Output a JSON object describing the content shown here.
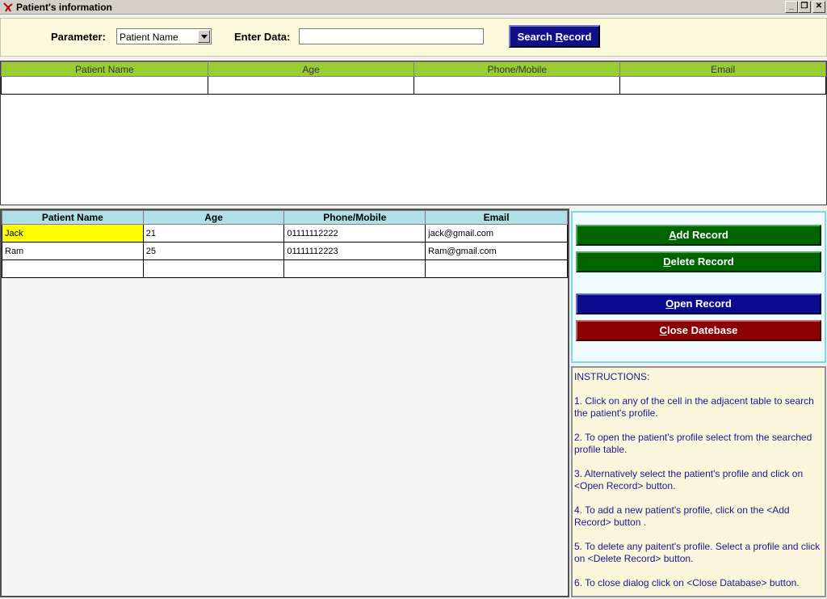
{
  "window": {
    "title": "Patient's information"
  },
  "search": {
    "parameter_label": "Parameter:",
    "parameter_value": "Patient Name",
    "enter_data_label": "Enter Data:",
    "data_value": "",
    "button_pre": "Search ",
    "button_key": "R",
    "button_post": "ecord"
  },
  "top_grid": {
    "columns": [
      "Patient Name",
      "Age",
      "Phone/Mobile",
      "Email"
    ]
  },
  "bottom_grid": {
    "columns": [
      "Patient Name",
      "Age",
      "Phone/Mobile",
      "Email"
    ],
    "rows": [
      {
        "name": "Jack",
        "age": "21",
        "phone": "01111112222",
        "email": "jack@gmail.com"
      },
      {
        "name": "Ram",
        "age": "25",
        "phone": "01111112223",
        "email": "Ram@gmail.com"
      }
    ]
  },
  "actions": {
    "add": {
      "key": "A",
      "rest": "dd Record"
    },
    "delete": {
      "key": "D",
      "rest": "elete Record"
    },
    "open": {
      "key": "O",
      "rest": "pen Record"
    },
    "close": {
      "key": "C",
      "rest": "lose Datebase"
    }
  },
  "instructions": {
    "heading": "INSTRUCTIONS:",
    "items": [
      "1. Click on any of the cell in the adjacent table to search the patient's profile.",
      "2. To open the patient's profile select from the searched profile table.",
      "3. Alternatively select the patient's profile and click on <Open Record> button.",
      "4. To add a new patient's profile, click on the <Add Record> button .",
      "5. To delete any paitent's profile. Select a profile and click on <Delete Record> button.",
      "6. To close dialog click on <Close Database> button."
    ]
  },
  "colors": {
    "top_header": "#9acd32",
    "bottom_header": "#b0e0e6",
    "selected_cell": "#ffff00",
    "search_button": "#0f0f8c",
    "add_delete": "#006400",
    "open": "#0a0a8c",
    "close": "#8b0000"
  }
}
